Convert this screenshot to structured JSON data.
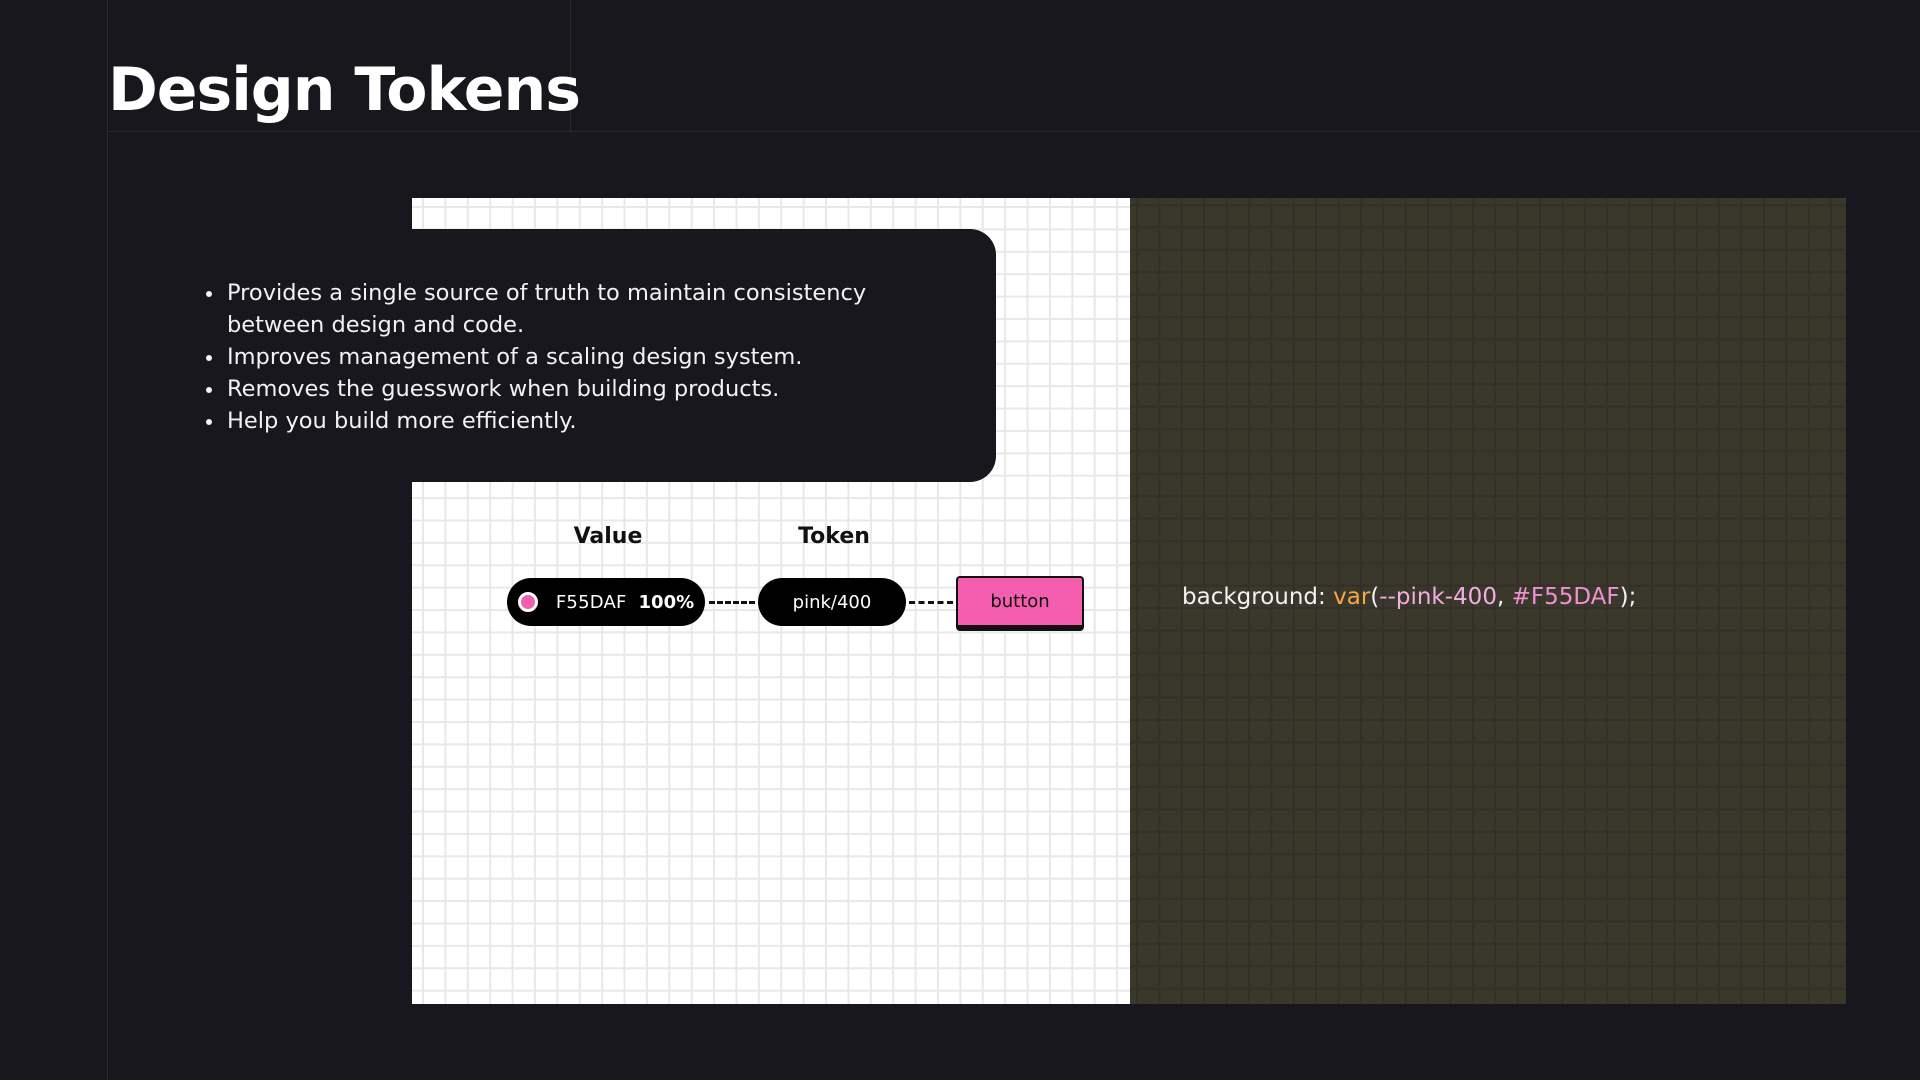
{
  "slide": {
    "title": "Design Tokens",
    "bullets": [
      "Provides a single source of truth to maintain consistency between design and code.",
      "Improves management of a scaling design system.",
      "Removes the guesswork when building products.",
      "Help you build more efficiently."
    ]
  },
  "diagram": {
    "value_label": "Value",
    "token_label": "Token",
    "value_hex": "F55DAF",
    "value_opacity": "100%",
    "token_name": "pink/400",
    "component_label": "button",
    "swatch_color": "#F55DAF"
  },
  "code": {
    "property": "background: ",
    "fn": "var",
    "open_paren": "(",
    "var_name": "--pink-400",
    "separator": ", ",
    "fallback": "#F55DAF",
    "close": ");"
  },
  "colors": {
    "background": "#18171e",
    "accent_pink": "#F55DAF",
    "code_panel": "#3a372b",
    "function_orange": "#f5a74a"
  }
}
